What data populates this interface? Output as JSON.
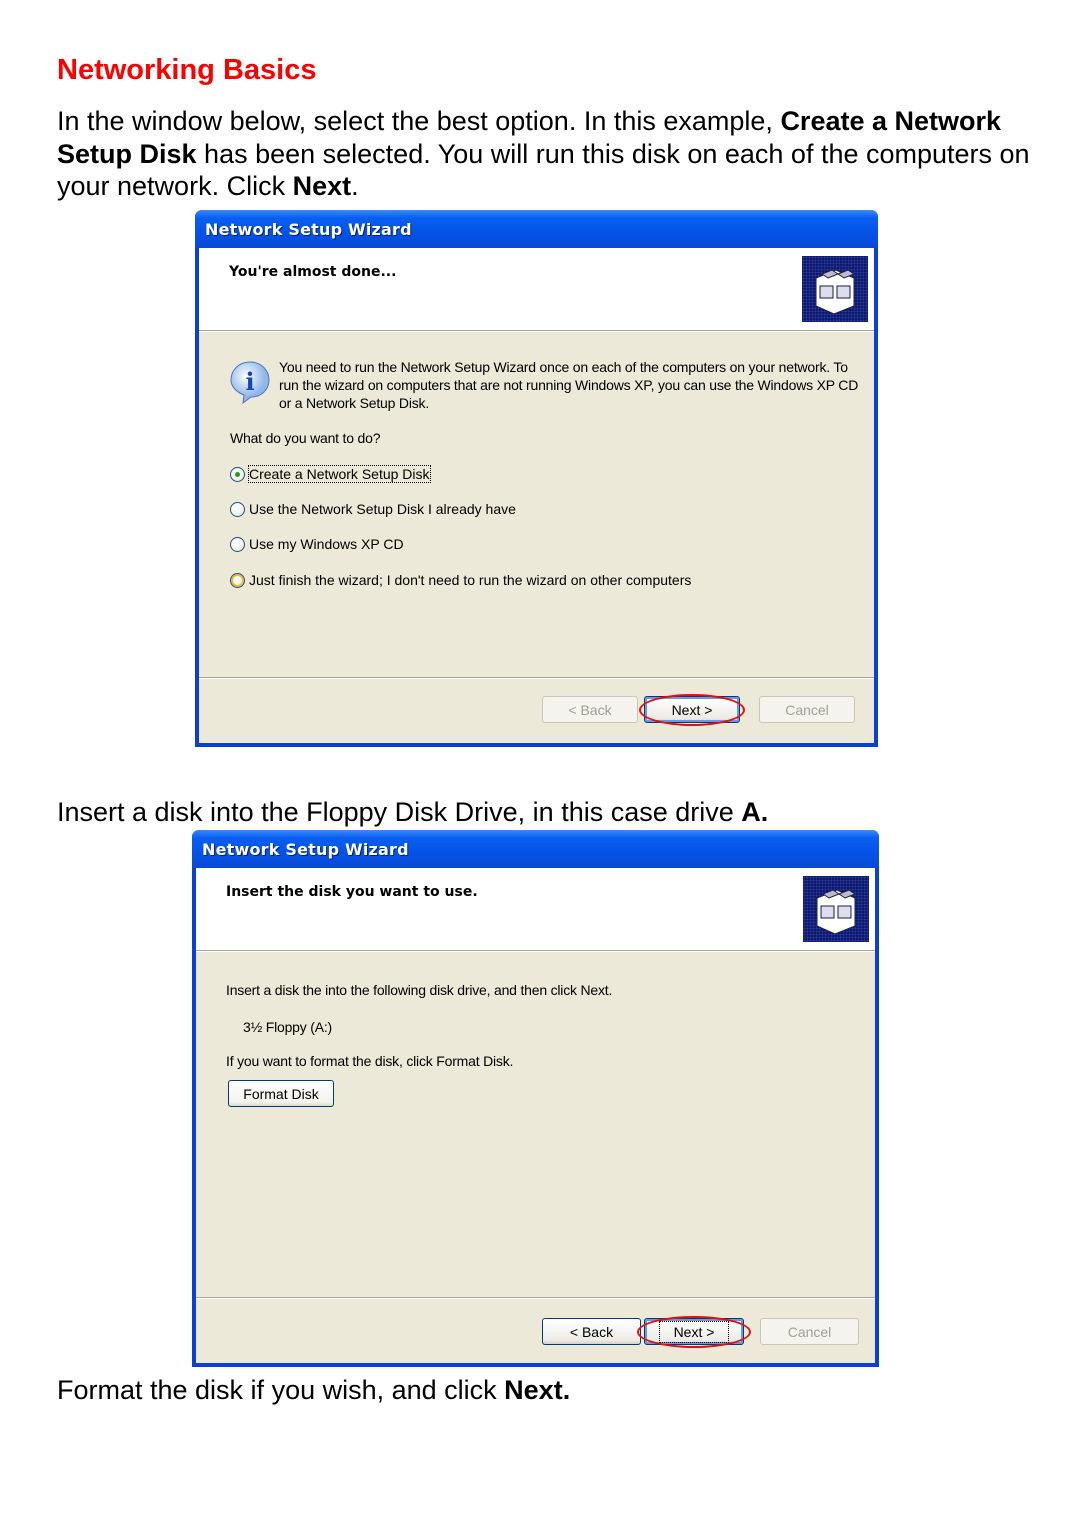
{
  "heading": "Networking Basics",
  "paragraphs": {
    "p1": {
      "t1": "In the window below, select the best option.  In this example, ",
      "b1": "Create a Network Setup Disk",
      "t2": " has been selected.  You will run this disk on each of the computers on your network.  Click ",
      "b2": "Next",
      "t3": "."
    },
    "p2": {
      "t1": "Insert a disk into the Floppy Disk Drive, in this case drive ",
      "b1": "A."
    },
    "p3": {
      "t1": "Format the disk if you wish, and click ",
      "b1": "Next."
    }
  },
  "wizard1": {
    "title": "Network Setup Wizard",
    "header": "You're almost done...",
    "info": "You need to run the Network Setup Wizard once on each of the computers on your network. To run the wizard on computers that are not running Windows XP, you can use the Windows XP CD or a Network Setup Disk.",
    "question": "What do you want to do?",
    "options": [
      {
        "label": "Create a Network Setup Disk",
        "checked": true
      },
      {
        "label": "Use the Network Setup Disk I already have",
        "checked": false
      },
      {
        "label": "Use my Windows XP CD",
        "checked": false
      },
      {
        "label": "Just finish the wizard; I don't need to run the wizard on other computers",
        "checked": false
      }
    ],
    "buttons": {
      "back": "< Back",
      "next": "Next >",
      "cancel": "Cancel"
    }
  },
  "wizard2": {
    "title": "Network Setup Wizard",
    "header": "Insert the disk you want to use.",
    "instruction": "Insert a disk the into the following disk drive, and then click Next.",
    "drive": "3½ Floppy (A:)",
    "format_hint": "If you want to format the disk, click Format Disk.",
    "format_button": "Format Disk",
    "buttons": {
      "back": "< Back",
      "next": "Next >",
      "cancel": "Cancel"
    }
  },
  "colors": {
    "heading": "#ff0000",
    "highlight_ellipse": "#e01010",
    "titlebar": "#0453e6",
    "dialog_bg": "#ece9d8"
  }
}
